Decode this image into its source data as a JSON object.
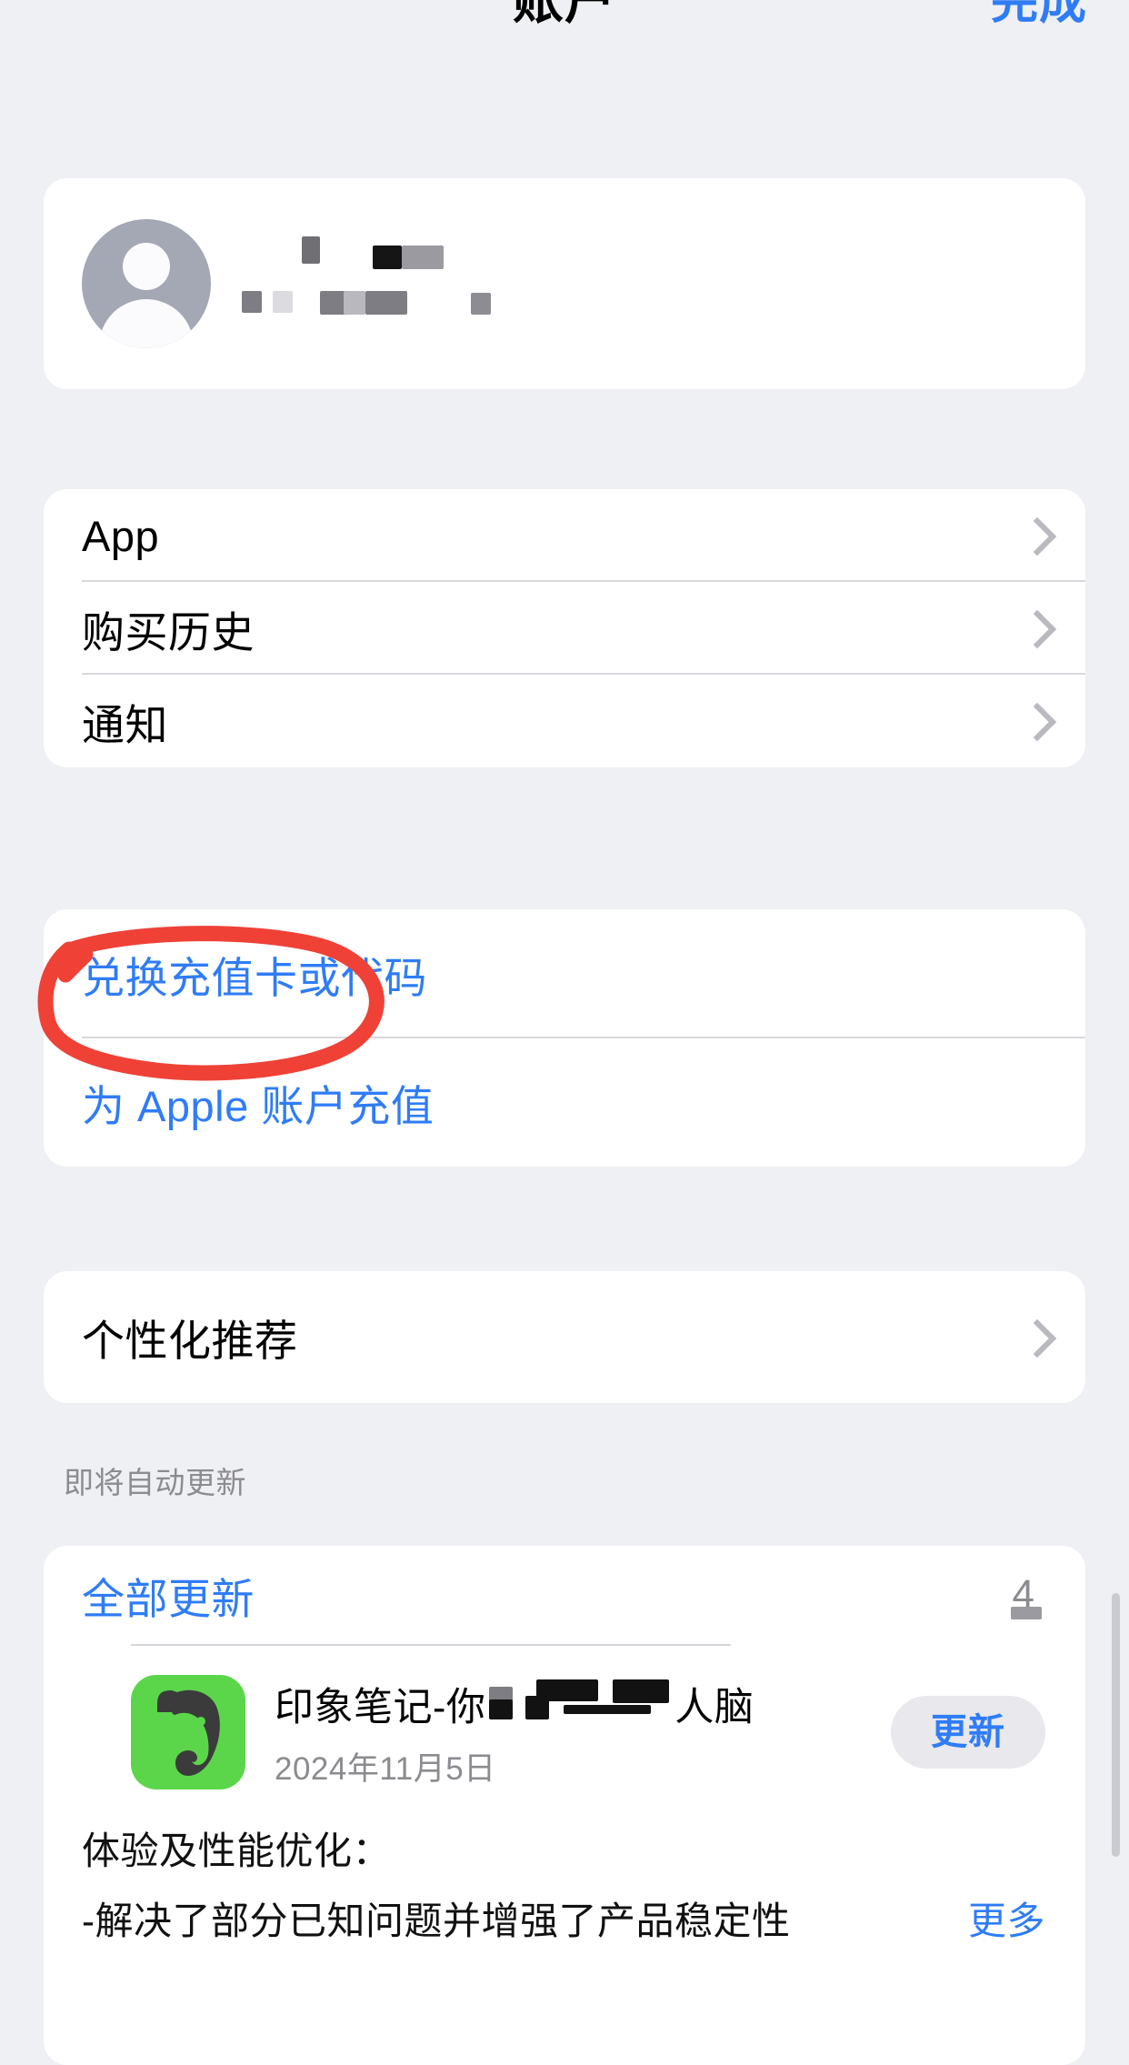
{
  "nav": {
    "title": "账户",
    "done_label": "完成"
  },
  "account": {
    "avatar_icon": "person-circle-icon",
    "name_redacted": true
  },
  "menu": {
    "items": [
      {
        "label": "App",
        "accessory": "chevron-right-icon"
      },
      {
        "label": "购买历史",
        "accessory": "chevron-right-icon"
      },
      {
        "label": "通知",
        "accessory": "chevron-right-icon"
      }
    ]
  },
  "redeem": {
    "items": [
      {
        "label": "兑换充值卡或代码",
        "highlighted": true
      },
      {
        "label": "为 Apple 账户充值",
        "highlighted": false
      }
    ]
  },
  "recommendations": {
    "items": [
      {
        "label": "个性化推荐",
        "accessory": "chevron-right-icon"
      }
    ]
  },
  "updates": {
    "section_header": "即将自动更新",
    "update_all_label": "全部更新",
    "update_count": "4",
    "apps": [
      {
        "icon": "evernote-elephant-icon",
        "name": "印象笔记-你",
        "name_suffix": "人脑",
        "date": "2024年11月5日",
        "button_label": "更新",
        "notes_title": "体验及性能优化：",
        "notes_line": "-解决了部分已知问题并增强了产品稳定性",
        "more_label": "更多"
      }
    ]
  },
  "colors": {
    "background": "#eff0f4",
    "card": "#ffffff",
    "accent_blue": "#2f7cf6",
    "annotation_red": "#ef4136",
    "secondary_text": "#8b8b90",
    "evernote_green": "#5bd64b"
  }
}
